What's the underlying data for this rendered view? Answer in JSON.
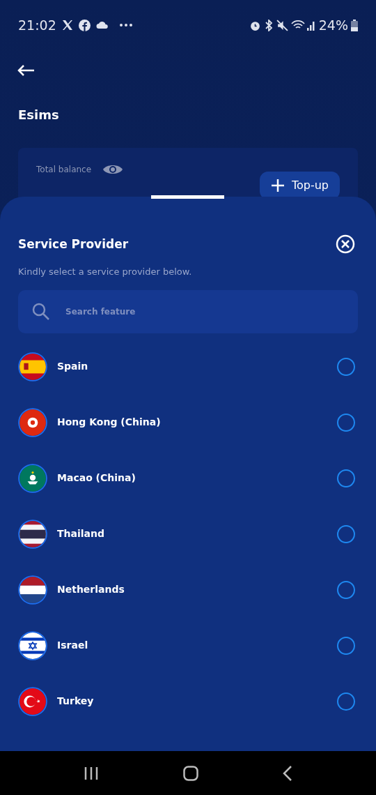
{
  "status_bar": {
    "time": "21:02",
    "battery": "24%"
  },
  "header": {
    "title": "Esims"
  },
  "balance_card": {
    "label": "Total balance",
    "button": "Top-up"
  },
  "sheet": {
    "title": "Service Provider",
    "subtitle": "Kindly select a service provider below.",
    "search": {
      "placeholder": "Search feature"
    },
    "providers": [
      {
        "name": "Spain",
        "kind": "spain",
        "selected": false
      },
      {
        "name": "Hong Kong (China)",
        "kind": "hongkong",
        "selected": false
      },
      {
        "name": "Macao (China)",
        "kind": "macao",
        "selected": false
      },
      {
        "name": "Thailand",
        "kind": "thailand",
        "selected": false
      },
      {
        "name": "Netherlands",
        "kind": "netherlands",
        "selected": false
      },
      {
        "name": "Israel",
        "kind": "israel",
        "selected": false
      },
      {
        "name": "Turkey",
        "kind": "turkey",
        "selected": false
      }
    ]
  }
}
